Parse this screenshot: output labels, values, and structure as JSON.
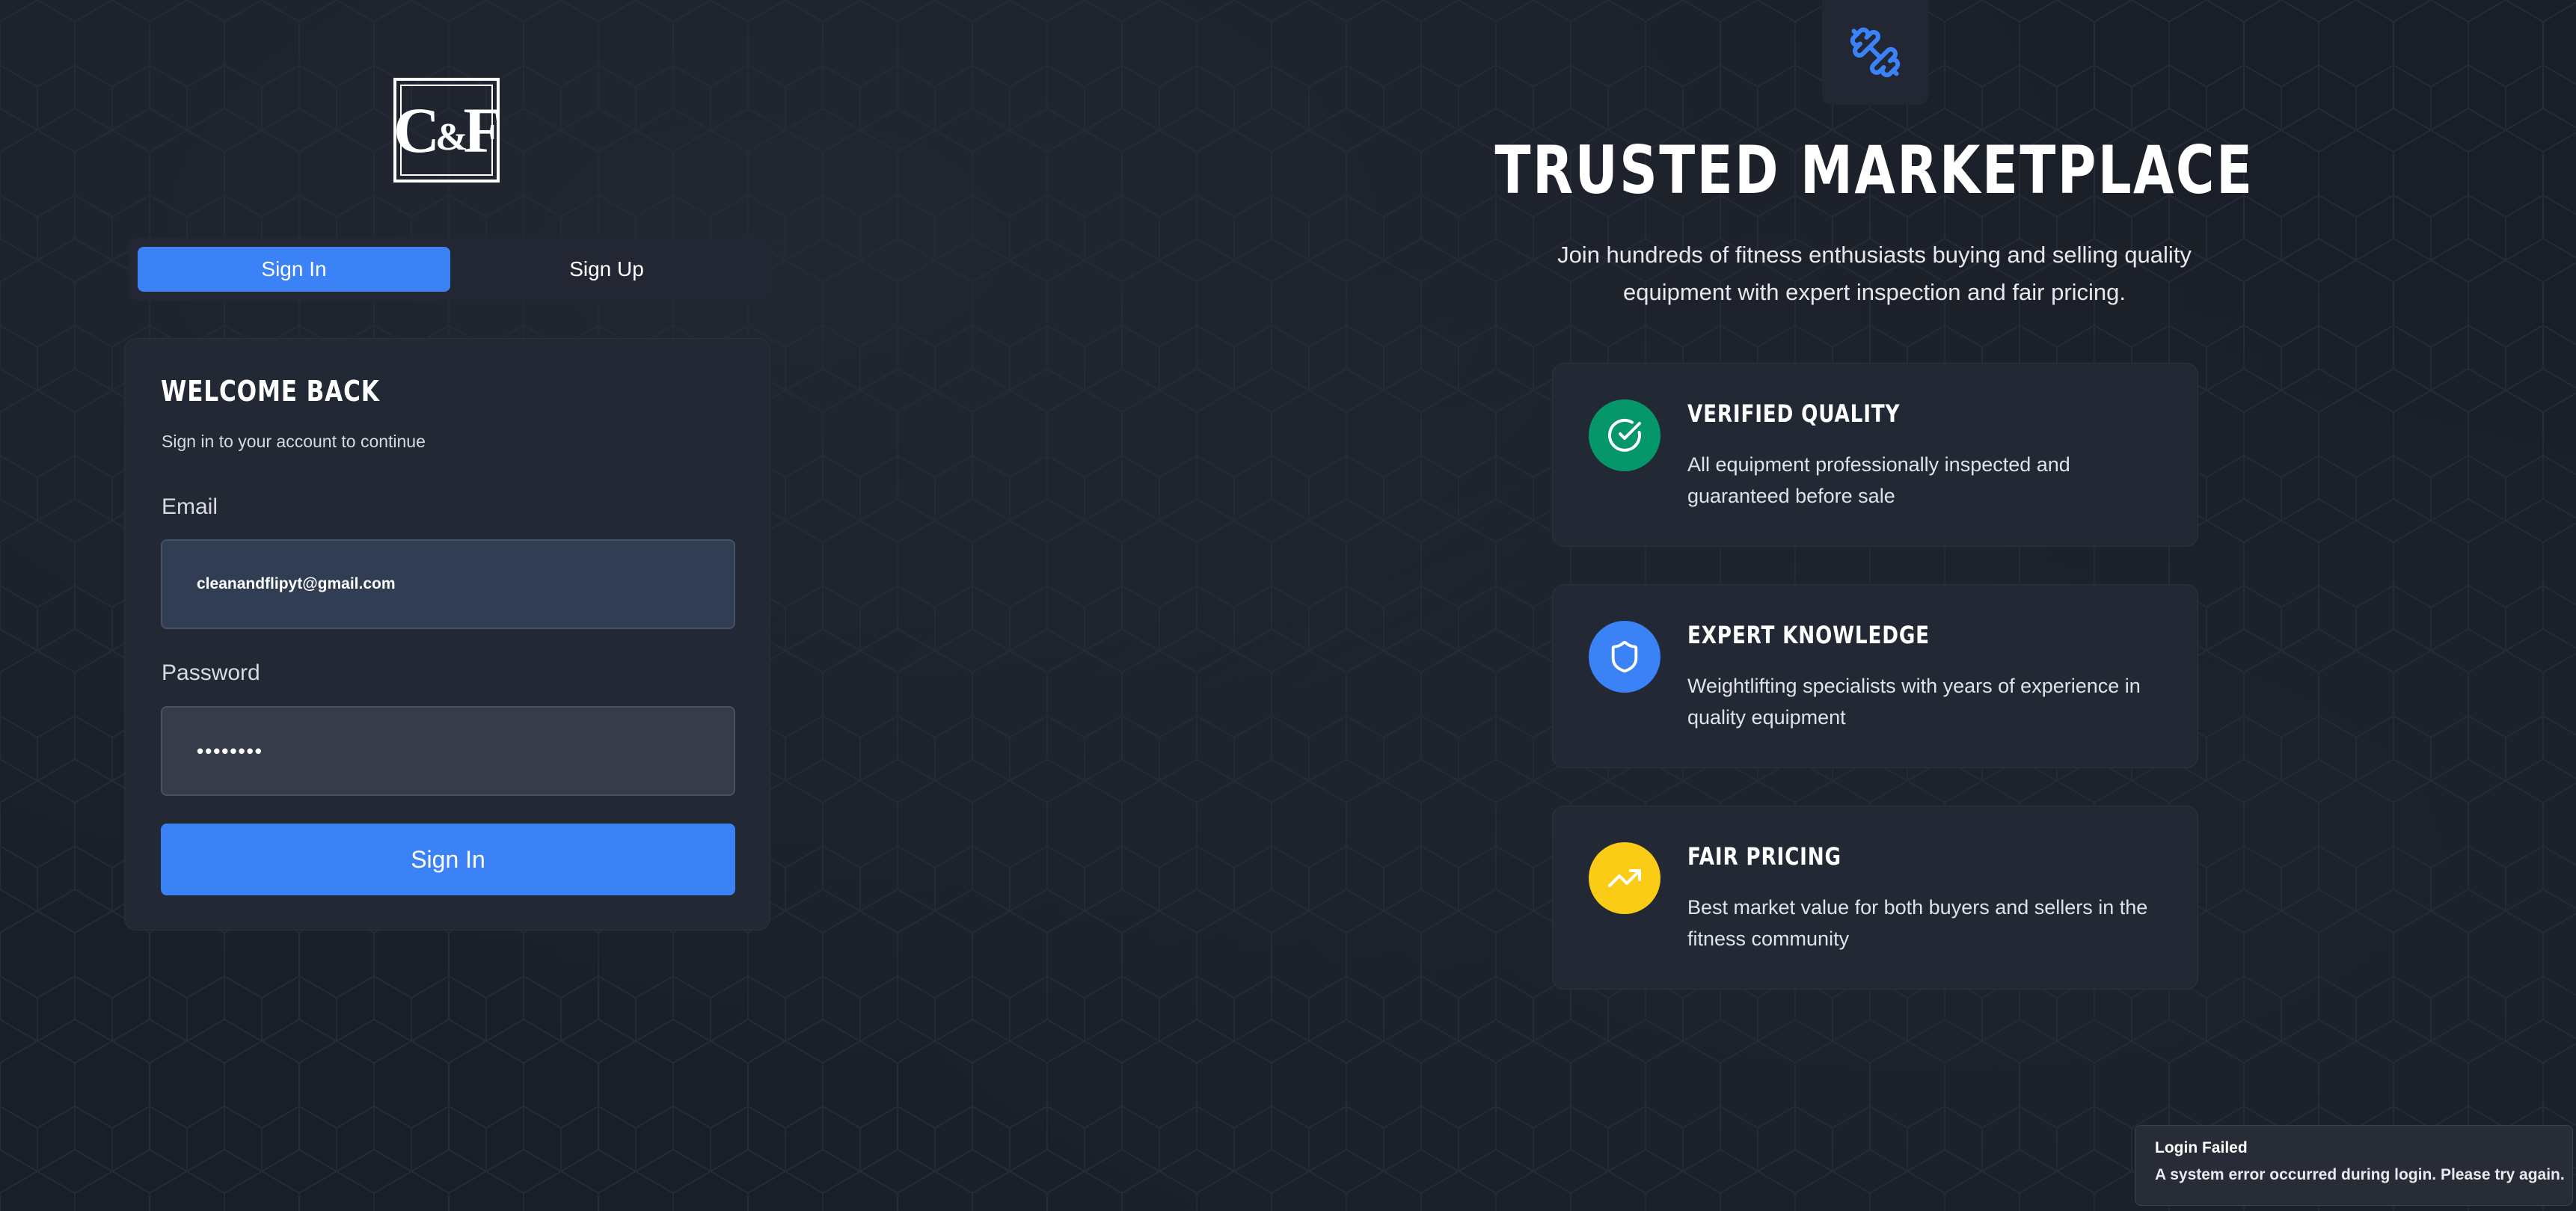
{
  "brand": {
    "logo_text": "C&F"
  },
  "auth_tabs": [
    {
      "label": "Sign In",
      "active": true
    },
    {
      "label": "Sign Up",
      "active": false
    }
  ],
  "login_card": {
    "title": "WELCOME BACK",
    "subtitle": "Sign in to your account to continue",
    "email_label": "Email",
    "email_value": "cleanandflipyt@gmail.com",
    "password_label": "Password",
    "password_value": "••••••••",
    "submit_label": "Sign In"
  },
  "hero": {
    "icon": "dumbbell-icon",
    "title": "TRUSTED MARKETPLACE",
    "subtitle_line1": "Join hundreds of fitness enthusiasts buying and selling quality",
    "subtitle_line2": "equipment with expert inspection and fair pricing."
  },
  "features": [
    {
      "icon": "check-circle-icon",
      "color": "#059669",
      "title": "VERIFIED QUALITY",
      "desc_line1": "All equipment professionally inspected and",
      "desc_line2": "guaranteed before sale"
    },
    {
      "icon": "shield-icon",
      "color": "#3b82f6",
      "title": "EXPERT KNOWLEDGE",
      "desc_line1": "Weightlifting specialists with years of experience in",
      "desc_line2": "quality equipment"
    },
    {
      "icon": "trending-up-icon",
      "color": "#facc15",
      "title": "FAIR PRICING",
      "desc_line1": "Best market value for both buyers and sellers in the",
      "desc_line2": "fitness community"
    }
  ],
  "toast": {
    "title": "Login Failed",
    "message": "A system error occurred during login. Please try again."
  },
  "colors": {
    "background": "#1a1e27",
    "card": "#232835",
    "accent": "#3b82f6"
  }
}
